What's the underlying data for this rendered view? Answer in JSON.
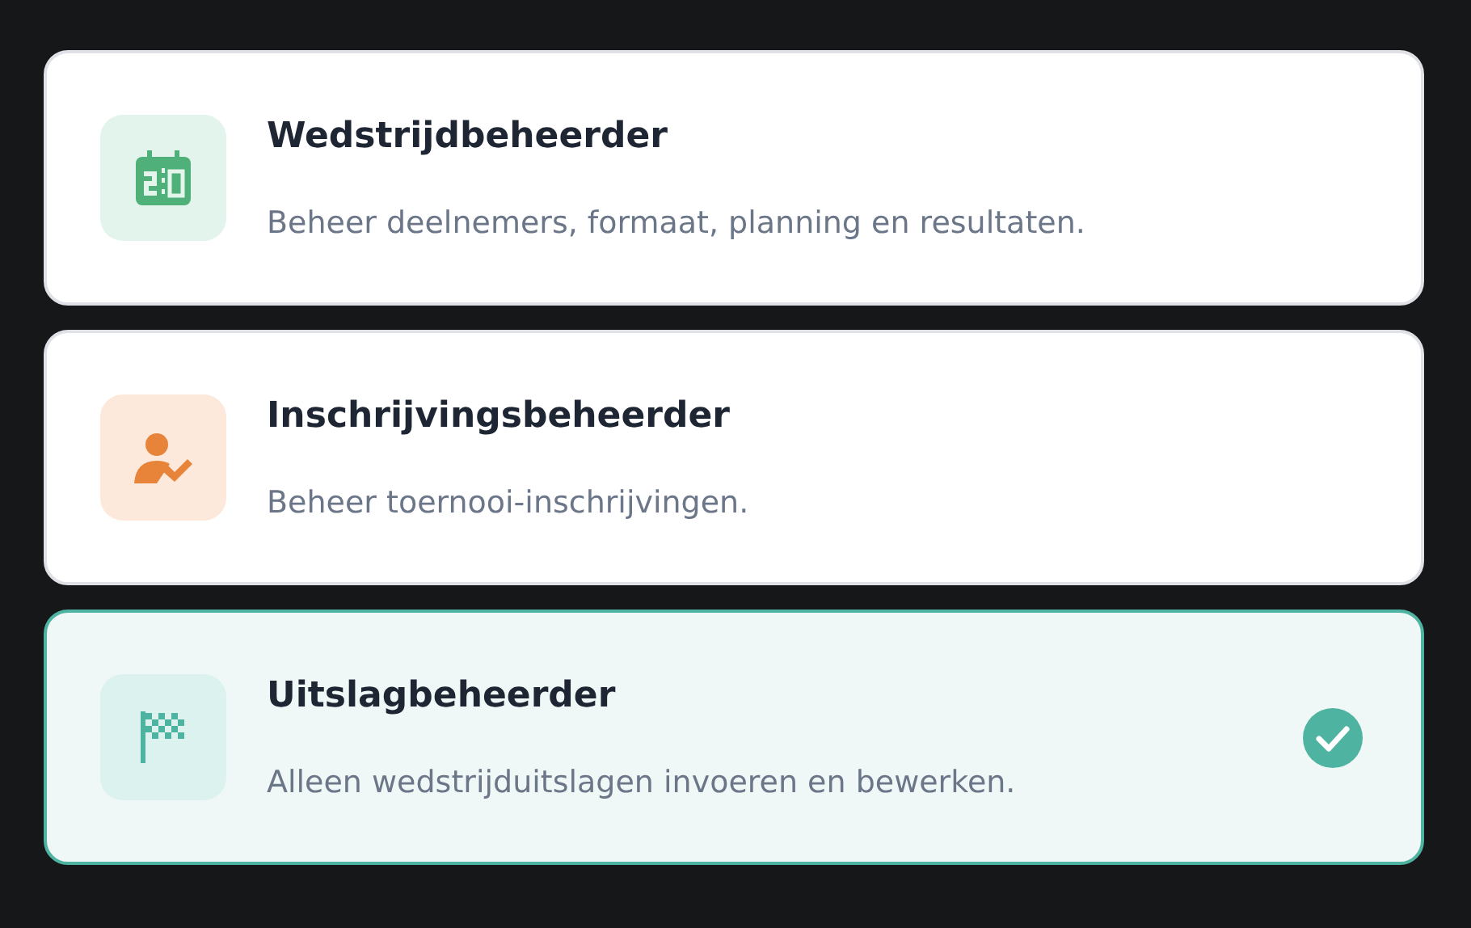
{
  "roles": [
    {
      "kind": "scoreboard",
      "title": "Wedstrijdbeheerder",
      "description": "Beheer deelnemers, formaat, planning en resultaten.",
      "selected": false
    },
    {
      "kind": "registration",
      "title": "Inschrijvingsbeheerder",
      "description": "Beheer toernooi-inschrijvingen.",
      "selected": false
    },
    {
      "kind": "results",
      "title": "Uitslagbeheerder",
      "description": "Alleen wedstrijduitslagen invoeren en bewerken.",
      "selected": true
    }
  ]
}
